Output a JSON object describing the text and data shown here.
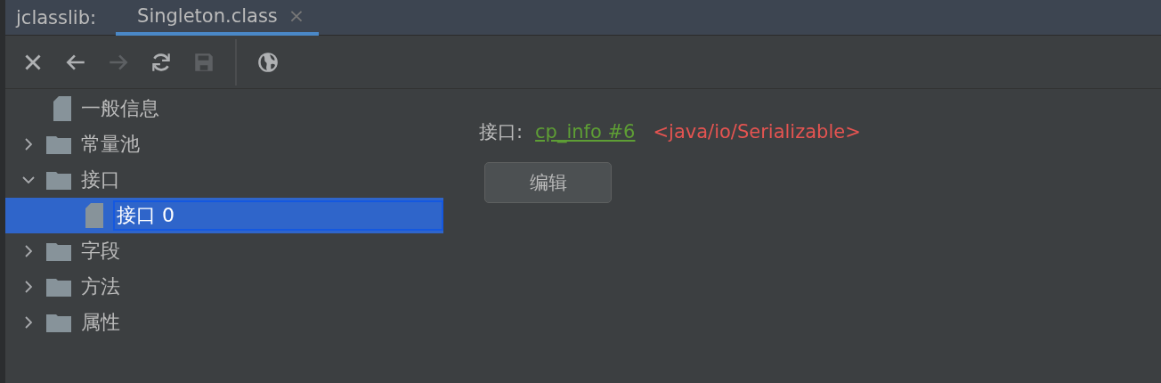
{
  "header": {
    "label": "jclasslib:",
    "tabs": [
      {
        "label": "Singleton.class",
        "selected": true,
        "close": "×"
      }
    ]
  },
  "toolbar": [
    {
      "kind": "close",
      "disabled": false
    },
    {
      "kind": "back",
      "disabled": false
    },
    {
      "kind": "forward",
      "disabled": true
    },
    {
      "kind": "reload",
      "disabled": false
    },
    {
      "kind": "save",
      "disabled": true
    },
    {
      "kind": "separator"
    },
    {
      "kind": "web",
      "disabled": false
    }
  ],
  "tree": [
    {
      "label": "一般信息",
      "kind": "file",
      "selected": false
    },
    {
      "label": "常量池",
      "kind": "folder",
      "expanded": false,
      "selected": false
    },
    {
      "label": "接口",
      "kind": "folder",
      "expanded": true,
      "selected": false,
      "children": [
        {
          "label": "接口 0",
          "kind": "file",
          "selected": true
        }
      ]
    },
    {
      "label": "字段",
      "kind": "folder",
      "expanded": false,
      "selected": false
    },
    {
      "label": "方法",
      "kind": "folder",
      "expanded": false,
      "selected": false
    },
    {
      "label": "属性",
      "kind": "folder",
      "expanded": false,
      "selected": false
    }
  ],
  "detail": {
    "label": "接口:",
    "link": "cp_info #6",
    "value": "<java/io/Serializable>",
    "button": "编辑"
  }
}
